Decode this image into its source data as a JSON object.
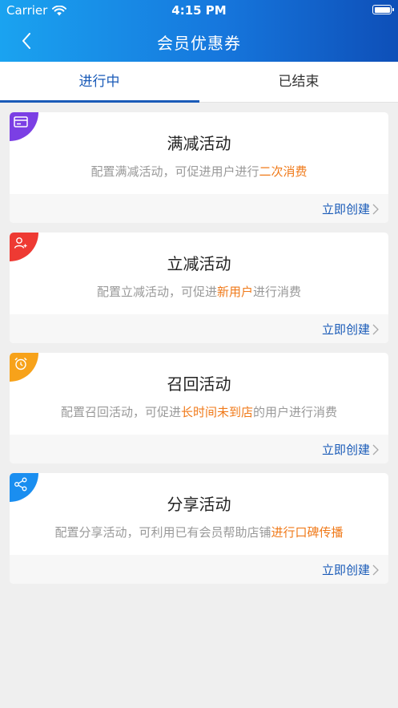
{
  "status_bar": {
    "carrier": "Carrier",
    "time": "4:15 PM"
  },
  "nav": {
    "title": "会员优惠券",
    "back_icon": "chevron-left-icon"
  },
  "tabs": [
    {
      "label": "进行中",
      "active": true
    },
    {
      "label": "已结束",
      "active": false
    }
  ],
  "colors": {
    "accent": "#1a5bb8",
    "highlight": "#f07a1a",
    "header_start": "#1aa3f0",
    "header_end": "#0e4fb8"
  },
  "cards": [
    {
      "title": "满减活动",
      "desc_pre": "配置满减活动，可促进用户进行",
      "desc_hl": "二次消费",
      "desc_post": "",
      "action": "立即创建",
      "icon": "card-icon",
      "corner_color": "#7b3fe4"
    },
    {
      "title": "立减活动",
      "desc_pre": "配置立减活动，可促进",
      "desc_hl": "新用户",
      "desc_post": "进行消费",
      "action": "立即创建",
      "icon": "user-add-icon",
      "corner_color": "#ee3a33"
    },
    {
      "title": "召回活动",
      "desc_pre": "配置召回活动，可促进",
      "desc_hl": "长时间未到店",
      "desc_post": "的用户进行消费",
      "action": "立即创建",
      "icon": "alarm-clock-icon",
      "corner_color": "#f7a21a"
    },
    {
      "title": "分享活动",
      "desc_pre": "配置分享活动，可利用已有会员帮助店铺",
      "desc_hl": "进行口碑传播",
      "desc_post": "",
      "action": "立即创建",
      "icon": "share-icon",
      "corner_color": "#1a8ef0"
    }
  ]
}
